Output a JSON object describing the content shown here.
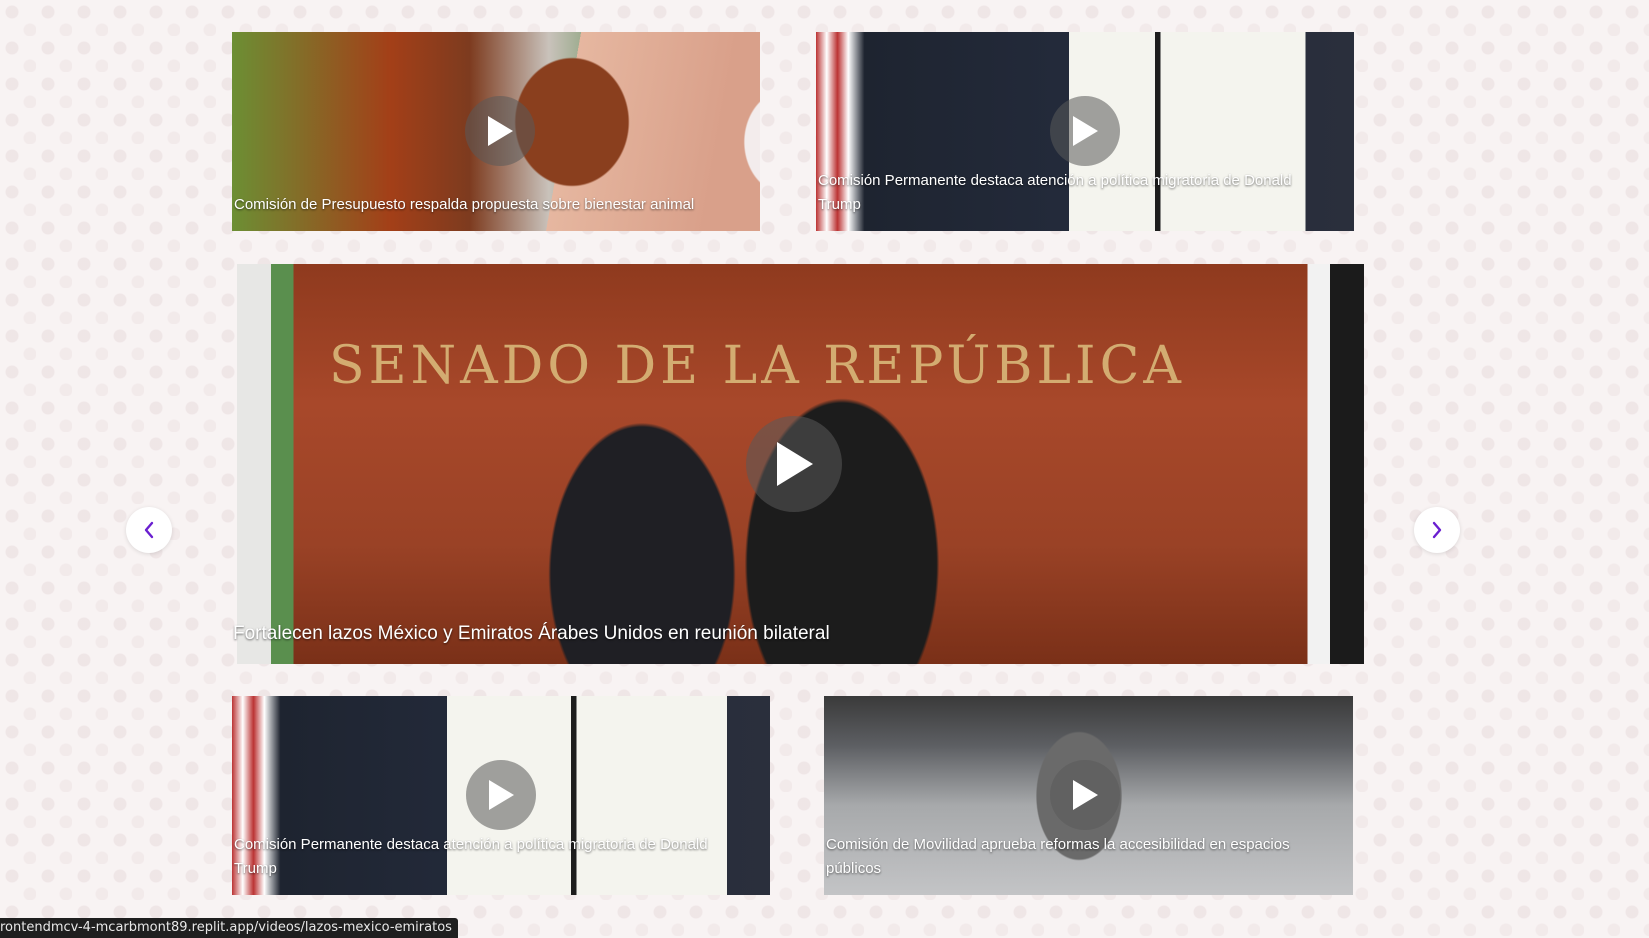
{
  "videos": {
    "top_left": {
      "title": "Comisión de Presupuesto respalda propuesta sobre bienestar animal",
      "thumbnail": "calf-with-hand"
    },
    "top_right": {
      "title": "Comisión Permanente destaca atención a política migratoria de Donald Trump",
      "thumbnail": "signed-order"
    },
    "featured": {
      "title": "Fortalecen lazos México y Emiratos Árabes Unidos en reunión bilateral",
      "thumbnail": "senado-handshake",
      "background_text": "SENADO DE LA REPÚBLICA"
    },
    "bottom_left": {
      "title": "Comisión Permanente destaca atención a política migratoria de Donald Trump",
      "thumbnail": "signed-order"
    },
    "bottom_right": {
      "title": "Comisión de Movilidad aprueba reformas la accesibilidad en espacios públicos",
      "thumbnail": "wheelchair-user"
    }
  },
  "carousel": {
    "prev_icon": "chevron-left-icon",
    "next_icon": "chevron-right-icon",
    "accent_color": "#6a1fd0"
  },
  "status_bar": {
    "url": "rontendmcv-4-mcarbmont89.replit.app/videos/lazos-mexico-emiratos"
  }
}
